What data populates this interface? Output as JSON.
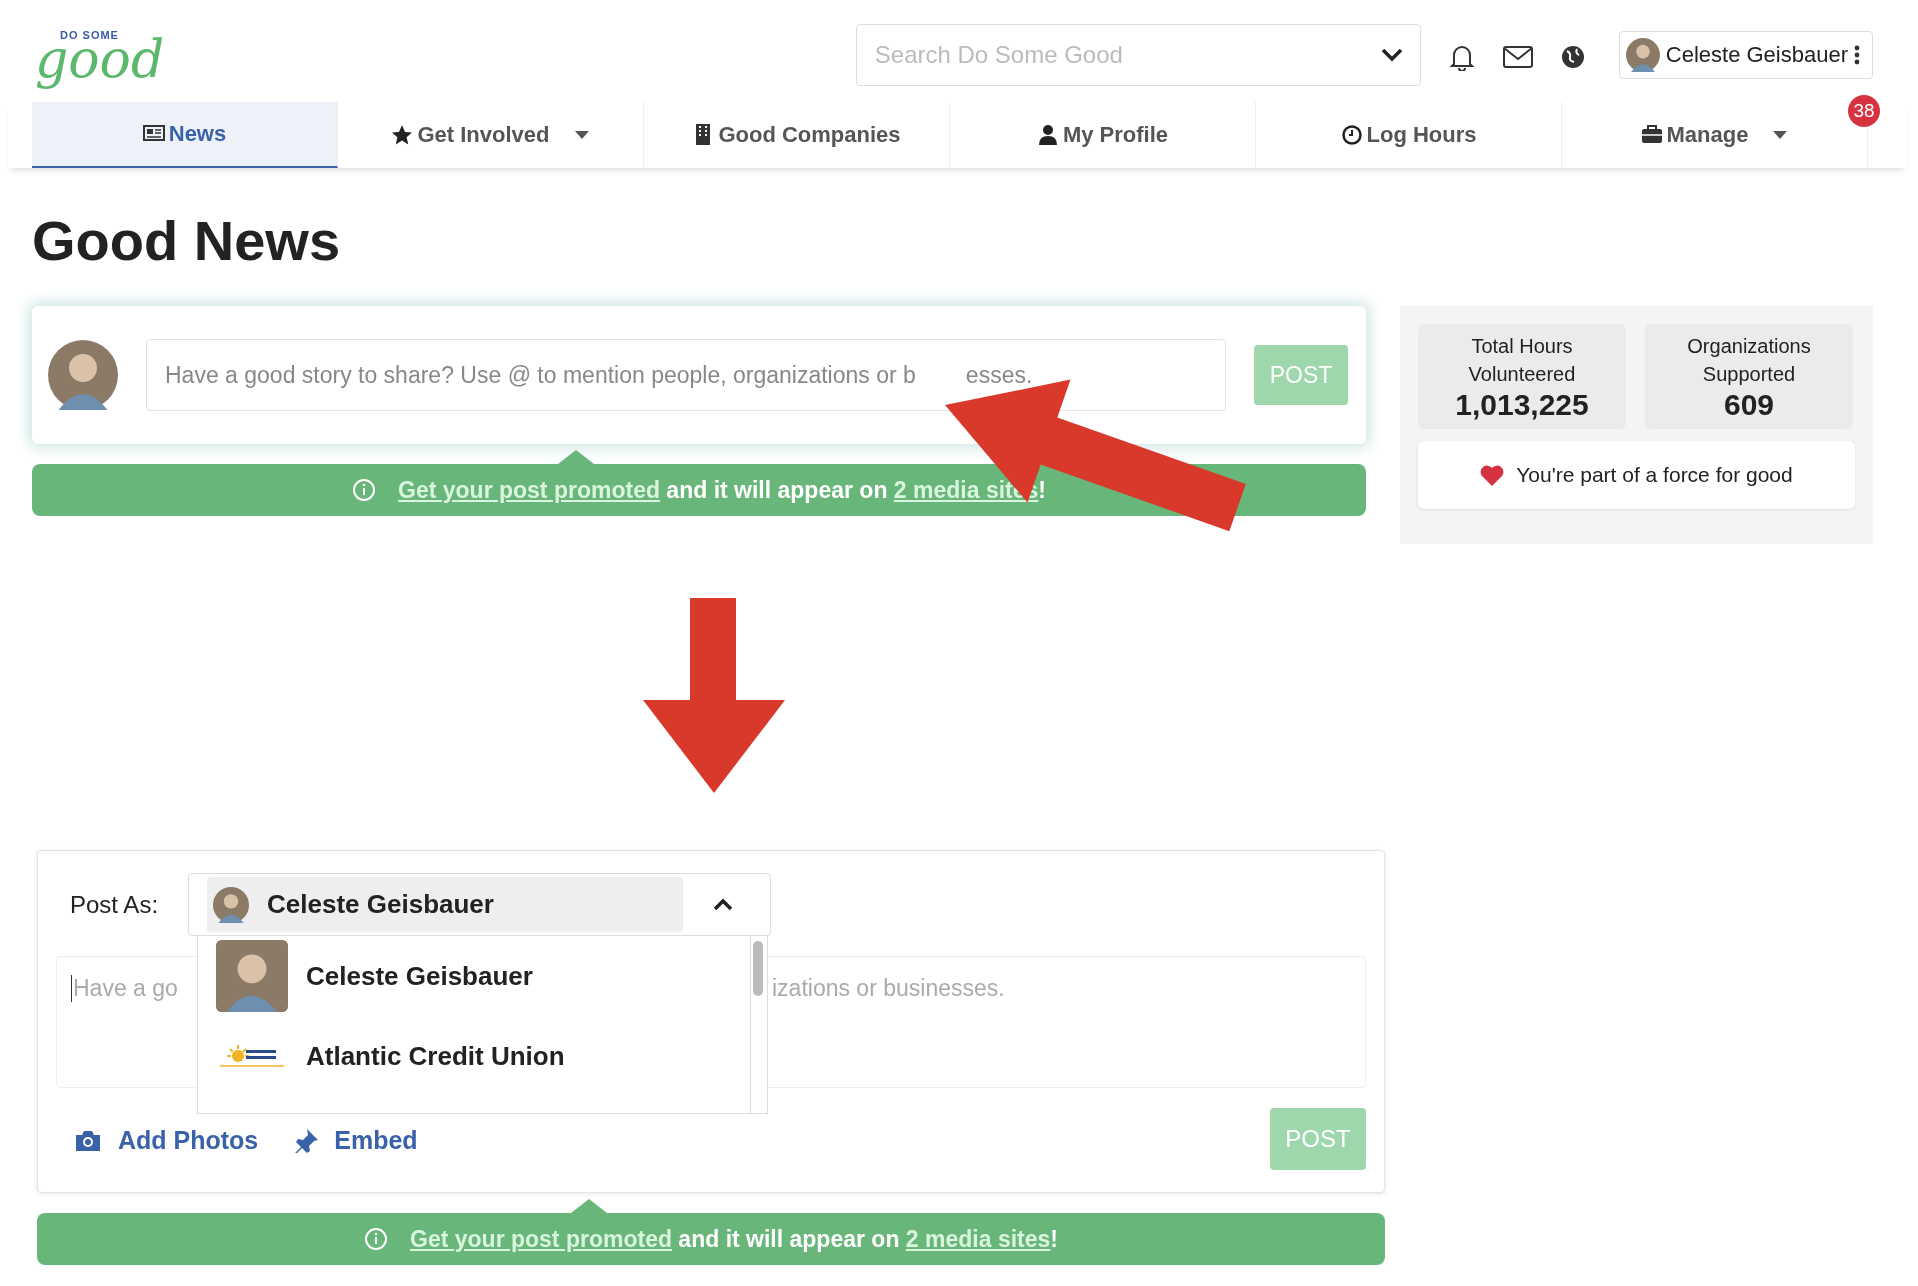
{
  "logo": {
    "small": "DO SOME",
    "large": "good"
  },
  "search": {
    "placeholder": "Search Do Some Good"
  },
  "user_menu": {
    "name": "Celeste Geisbauer"
  },
  "notification_badge": "38",
  "nav_tabs": [
    {
      "label": "News",
      "kind": "news",
      "selected": true,
      "has_dropdown": false
    },
    {
      "label": "Get Involved",
      "kind": "star",
      "selected": false,
      "has_dropdown": true
    },
    {
      "label": "Good Companies",
      "kind": "building",
      "selected": false,
      "has_dropdown": false
    },
    {
      "label": "My Profile",
      "kind": "person",
      "selected": false,
      "has_dropdown": false
    },
    {
      "label": "Log Hours",
      "kind": "clock",
      "selected": false,
      "has_dropdown": false
    },
    {
      "label": "Manage",
      "kind": "briefcase",
      "selected": false,
      "has_dropdown": true
    }
  ],
  "page_title": "Good News",
  "composer": {
    "placeholder_parts": [
      "Have a good story to share? Use @ to mention people, organizations or b",
      "esses."
    ],
    "post_button": "POST"
  },
  "promo_banner": {
    "link_1": "Get your post promoted",
    "text": "and it will appear on",
    "link_2": "2 media sites",
    "end": "!"
  },
  "stats": [
    {
      "label": "Total Hours Volunteered",
      "value": "1,013,225"
    },
    {
      "label": "Organizations Supported",
      "value": "609"
    }
  ],
  "force_message": "You're part of a force for good",
  "expanded_composer": {
    "post_as_label": "Post As:",
    "selected_identity": "Celeste Geisbauer",
    "dropdown_open": true,
    "options": [
      {
        "name": "Celeste Geisbauer",
        "kind": "person"
      },
      {
        "name": "Atlantic Credit Union",
        "kind": "organization"
      }
    ],
    "placeholder_parts": [
      "Have a go",
      "izations or businesses."
    ],
    "actions": [
      {
        "label": "Add Photos",
        "kind": "photo"
      },
      {
        "label": "Embed",
        "kind": "embed"
      }
    ],
    "post_button": "POST"
  },
  "promo_banner_2": {
    "link_1": "Get your post promoted",
    "text": "and it will appear on",
    "link_2": "2 media sites",
    "end": "!"
  }
}
